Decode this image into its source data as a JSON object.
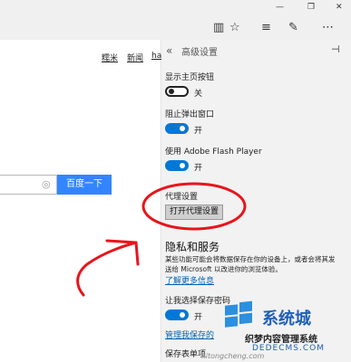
{
  "window": {
    "minimize": "—",
    "restore": "❐",
    "close": "✕"
  },
  "toolbar": {
    "reading_view": "▥",
    "favorite": "☆",
    "hub": "≡",
    "notes": "✎",
    "more": "⋯"
  },
  "left_page": {
    "nav_links": [
      "糯米",
      "新闻",
      "ha"
    ],
    "search_button": "百度一下",
    "camera": "◎"
  },
  "settings": {
    "back": "«",
    "title": "高级设置",
    "pin": "⊣",
    "home_button": {
      "label": "显示主页按钮",
      "state": "关",
      "on": false
    },
    "popup_block": {
      "label": "阻止弹出窗口",
      "state": "开",
      "on": true
    },
    "flash": {
      "label": "使用 Adobe Flash Player",
      "state": "开",
      "on": true
    },
    "proxy": {
      "label": "代理设置",
      "button": "打开代理设置"
    },
    "privacy": {
      "heading": "隐私和服务",
      "desc_line1": "某些功能可能会将数据保存在你的设备上，或者会将其发",
      "desc_line2": "送给 Microsoft 以改进你的浏览体验。",
      "learn_more": "了解更多信息"
    },
    "save_password": {
      "label": "让我选择保存密码",
      "state": "开",
      "on": true
    },
    "manage_passwords": "管理我保存的",
    "save_form": "保存表单项"
  },
  "watermark": {
    "brand": "系统城",
    "site_cn": "织梦内容管理系统",
    "site_en": "DEDECMS.COM",
    "url": "xitongcheng.com"
  },
  "colors": {
    "accent": "#0078d7",
    "search_button": "#3385ff",
    "annotation": "#e8141c"
  }
}
